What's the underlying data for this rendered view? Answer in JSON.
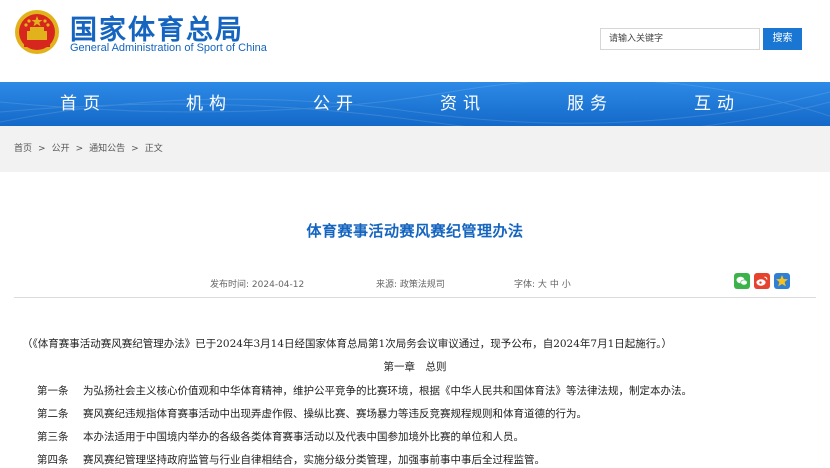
{
  "header": {
    "site_name": "国家体育总局",
    "site_name_en": "General Administration of Sport of China",
    "search_placeholder": "请输入关键字",
    "search_button": "搜索"
  },
  "nav": {
    "items": [
      "首页",
      "机构",
      "公开",
      "资讯",
      "服务",
      "互动"
    ]
  },
  "breadcrumb": {
    "items": [
      "首页",
      "公开",
      "通知公告",
      "正文"
    ],
    "separator": ">"
  },
  "article": {
    "title": "体育赛事活动赛风赛纪管理办法",
    "publish_label": "发布时间:",
    "publish_date": "2024-04-12",
    "source_label": "来源:",
    "source": "政策法规司",
    "font_label": "字体:",
    "font_sizes": [
      "大",
      "中",
      "小"
    ],
    "share_icons": [
      "wechat-icon",
      "weibo-icon",
      "qzone-icon"
    ],
    "intro": "（《体育赛事活动赛风赛纪管理办法》已于2024年3月14日经国家体育总局第1次局务会议审议通过，现予公布，自2024年7月1日起施行。）",
    "chapter": "第一章　总则",
    "articles": [
      {
        "no": "第一条",
        "text": "为弘扬社会主义核心价值观和中华体育精神，维护公平竞争的比赛环境，根据《中华人民共和国体育法》等法律法规，制定本办法。"
      },
      {
        "no": "第二条",
        "text": "赛风赛纪违规指体育赛事活动中出现弄虚作假、操纵比赛、赛场暴力等违反竞赛规程规则和体育道德的行为。"
      },
      {
        "no": "第三条",
        "text": "本办法适用于中国境内举办的各级各类体育赛事活动以及代表中国参加境外比赛的单位和人员。"
      },
      {
        "no": "第四条",
        "text": "赛风赛纪管理坚持政府监管与行业自律相结合，实施分级分类管理，加强事前事中事后全过程监管。"
      }
    ]
  },
  "colors": {
    "brand_blue": "#1565c0",
    "nav_blue": "#1e7ad8",
    "search_button": "#1976d2"
  }
}
